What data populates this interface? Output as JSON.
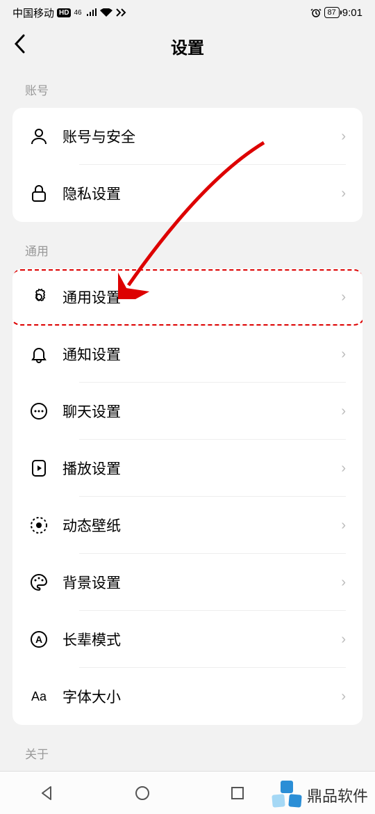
{
  "statusBar": {
    "carrier": "中国移动",
    "hd": "HD",
    "sig": "46",
    "battery": "87",
    "time": "9:01"
  },
  "header": {
    "title": "设置"
  },
  "sections": {
    "account": {
      "label": "账号"
    },
    "general": {
      "label": "通用"
    },
    "about": {
      "label": "关于"
    }
  },
  "items": {
    "accountSecurity": "账号与安全",
    "privacy": "隐私设置",
    "generalSettings": "通用设置",
    "notification": "通知设置",
    "chat": "聊天设置",
    "playback": "播放设置",
    "wallpaper": "动态壁纸",
    "background": "背景设置",
    "elderMode": "长辈模式",
    "fontSize": "字体大小"
  },
  "watermark": {
    "text": "鼎品软件"
  }
}
